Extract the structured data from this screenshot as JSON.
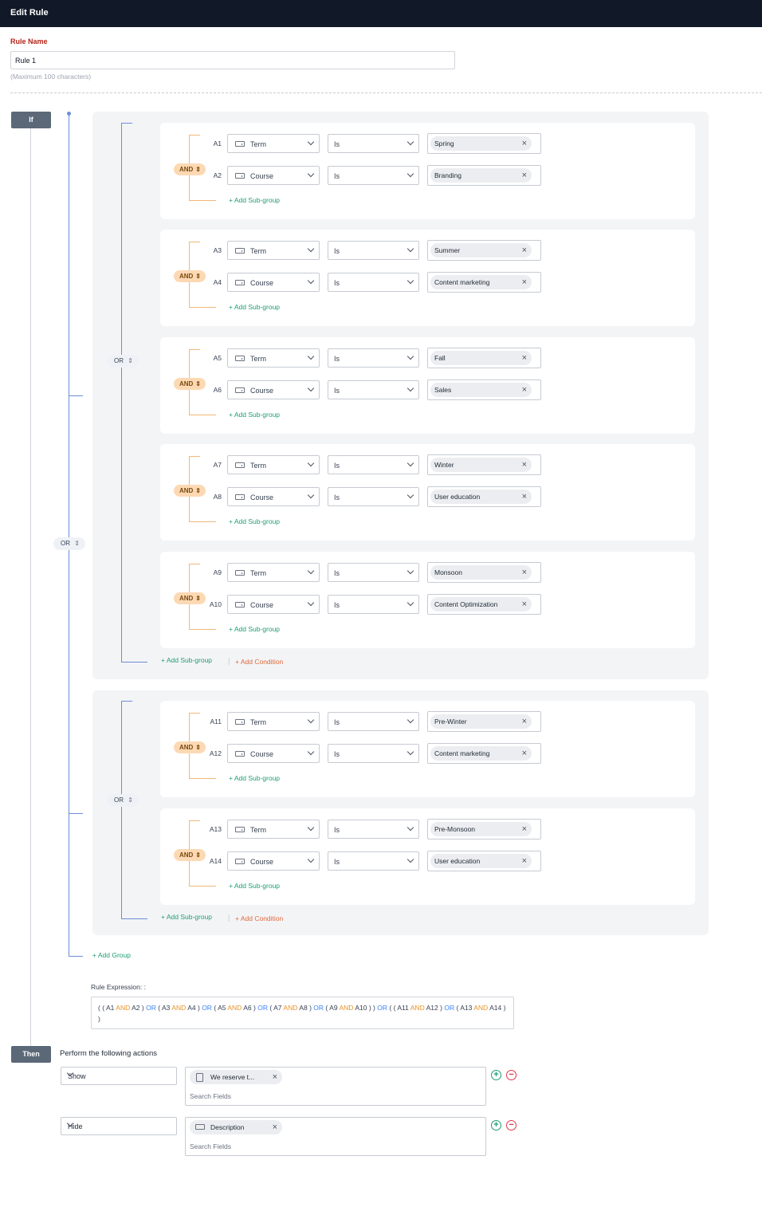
{
  "header": {
    "title": "Edit Rule"
  },
  "rule_name": {
    "label": "Rule Name",
    "value": "Rule 1",
    "hint": "(Maximum 100 characters)"
  },
  "if_label": "If",
  "then_label": "Then",
  "operators": {
    "or": "OR",
    "and": "AND"
  },
  "links": {
    "add_subgroup": "+ Add Sub-group",
    "add_condition": "+ Add Condition",
    "add_group": "+ Add Group",
    "separator": "|"
  },
  "groups": [
    {
      "subgroups": [
        {
          "conditions": [
            {
              "id": "A1",
              "field": "Term",
              "op": "Is",
              "value": "Spring"
            },
            {
              "id": "A2",
              "field": "Course",
              "op": "Is",
              "value": "Branding"
            }
          ]
        },
        {
          "conditions": [
            {
              "id": "A3",
              "field": "Term",
              "op": "Is",
              "value": "Summer"
            },
            {
              "id": "A4",
              "field": "Course",
              "op": "Is",
              "value": "Content marketing"
            }
          ]
        },
        {
          "conditions": [
            {
              "id": "A5",
              "field": "Term",
              "op": "Is",
              "value": "Fall"
            },
            {
              "id": "A6",
              "field": "Course",
              "op": "Is",
              "value": "Sales"
            }
          ]
        },
        {
          "conditions": [
            {
              "id": "A7",
              "field": "Term",
              "op": "Is",
              "value": "Winter"
            },
            {
              "id": "A8",
              "field": "Course",
              "op": "Is",
              "value": "User education"
            }
          ]
        },
        {
          "conditions": [
            {
              "id": "A9",
              "field": "Term",
              "op": "Is",
              "value": "Monsoon"
            },
            {
              "id": "A10",
              "field": "Course",
              "op": "Is",
              "value": "Content Optimization"
            }
          ]
        }
      ]
    },
    {
      "subgroups": [
        {
          "conditions": [
            {
              "id": "A11",
              "field": "Term",
              "op": "Is",
              "value": "Pre-Winter"
            },
            {
              "id": "A12",
              "field": "Course",
              "op": "Is",
              "value": "Content marketing"
            }
          ]
        },
        {
          "conditions": [
            {
              "id": "A13",
              "field": "Term",
              "op": "Is",
              "value": "Pre-Monsoon"
            },
            {
              "id": "A14",
              "field": "Course",
              "op": "Is",
              "value": "User education"
            }
          ]
        }
      ]
    }
  ],
  "rule_expression": {
    "label": "Rule Expression: :",
    "tokens": [
      "(",
      "(",
      "A1",
      "AND",
      "A2",
      ")",
      "OR",
      "(",
      "A3",
      "AND",
      "A4",
      ")",
      "OR",
      "(",
      "A5",
      "AND",
      "A6",
      ")",
      "OR",
      "(",
      "A7",
      "AND",
      "A8",
      ")",
      "OR",
      "(",
      "A9",
      "AND",
      "A10",
      ")",
      ")",
      "OR",
      "(",
      "(",
      "A11",
      "AND",
      "A12",
      ")",
      "OR",
      "(",
      "A13",
      "AND",
      "A14",
      ")",
      ")"
    ]
  },
  "then": {
    "title": "Perform the following actions",
    "actions": [
      {
        "action": "Show",
        "chip": "We reserve t...",
        "chip_icon": "document-icon",
        "placeholder": "Search Fields"
      },
      {
        "action": "Hide",
        "chip": "Description",
        "chip_icon": "text-field-icon",
        "placeholder": "Search Fields"
      }
    ]
  },
  "colors": {
    "header_bg": "#111827",
    "and_pill": "#fcd9b3",
    "or_line": "#6d8ed7",
    "add_green": "#1f9d74",
    "add_orange": "#e06a3d"
  }
}
